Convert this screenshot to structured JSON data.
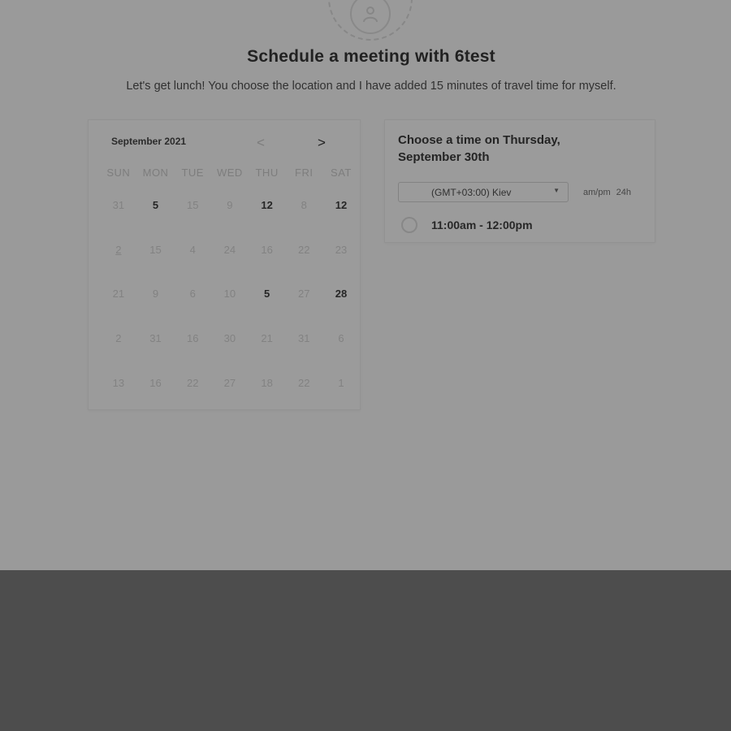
{
  "header": {
    "title": "Schedule a meeting with 6test",
    "subtitle": "Let's get lunch! You choose the location and I have added 15 minutes of travel time for myself."
  },
  "calendar": {
    "month_label": "September 2021",
    "prev_icon": "<",
    "next_icon": ">",
    "weekdays": [
      "SUN",
      "MON",
      "TUE",
      "WED",
      "THU",
      "FRI",
      "SAT"
    ],
    "weeks": [
      [
        "31",
        "5",
        "15",
        "9",
        "12",
        "8",
        "12"
      ],
      [
        "2",
        "15",
        "4",
        "24",
        "16",
        "22",
        "23"
      ],
      [
        "21",
        "9",
        "6",
        "10",
        "5",
        "27",
        "28"
      ],
      [
        "2",
        "31",
        "16",
        "30",
        "21",
        "31",
        "6"
      ],
      [
        "13",
        "16",
        "22",
        "27",
        "18",
        "22",
        "1"
      ]
    ]
  },
  "time_panel": {
    "title": "Choose a time on Thursday, September 30th",
    "timezone": "(GMT+03:00) Kiev",
    "format_ampm": "am/pm",
    "format_24h": "24h",
    "slots": [
      "11:00am - 12:00pm"
    ]
  }
}
